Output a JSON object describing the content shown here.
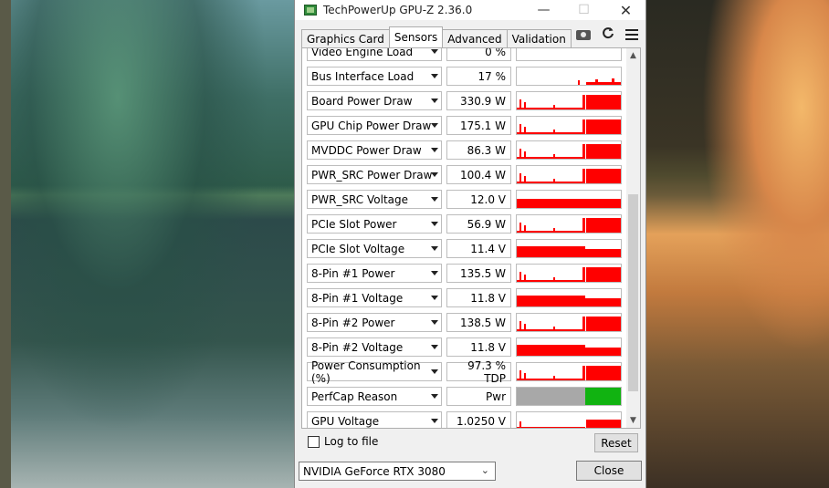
{
  "window": {
    "title": "TechPowerUp GPU-Z 2.36.0",
    "minimize_glyph": "—",
    "maximize_glyph": "☐",
    "close_glyph": "✕"
  },
  "tabs": [
    {
      "label": "Graphics Card",
      "active": false
    },
    {
      "label": "Sensors",
      "active": true
    },
    {
      "label": "Advanced",
      "active": false
    },
    {
      "label": "Validation",
      "active": false
    }
  ],
  "toolbar_icons": [
    "camera-icon",
    "refresh-icon",
    "menu-icon"
  ],
  "colors": {
    "graph_red": "#ff0000",
    "graph_green": "#11b311",
    "graph_gray": "#a8a8a8"
  },
  "sensors": [
    {
      "name": "Video Engine Load",
      "value": "0 %"
    },
    {
      "name": "Bus Interface Load",
      "value": "17 %"
    },
    {
      "name": "Board Power Draw",
      "value": "330.9 W"
    },
    {
      "name": "GPU Chip Power Draw",
      "value": "175.1 W"
    },
    {
      "name": "MVDDC Power Draw",
      "value": "86.3 W"
    },
    {
      "name": "PWR_SRC Power Draw",
      "value": "100.4 W"
    },
    {
      "name": "PWR_SRC Voltage",
      "value": "12.0 V"
    },
    {
      "name": "PCIe Slot Power",
      "value": "56.9 W"
    },
    {
      "name": "PCIe Slot Voltage",
      "value": "11.4 V"
    },
    {
      "name": "8-Pin #1 Power",
      "value": "135.5 W"
    },
    {
      "name": "8-Pin #1 Voltage",
      "value": "11.8 V"
    },
    {
      "name": "8-Pin #2 Power",
      "value": "138.5 W"
    },
    {
      "name": "8-Pin #2 Voltage",
      "value": "11.8 V"
    },
    {
      "name": "Power Consumption (%)",
      "value": "97.3 % TDP"
    },
    {
      "name": "PerfCap Reason",
      "value": "Pwr"
    },
    {
      "name": "GPU Voltage",
      "value": "1.0250 V"
    }
  ],
  "log_to_file": {
    "label": "Log to file",
    "checked": false
  },
  "reset_label": "Reset",
  "gpu_select": {
    "value": "NVIDIA GeForce RTX 3080"
  },
  "close_label": "Close"
}
